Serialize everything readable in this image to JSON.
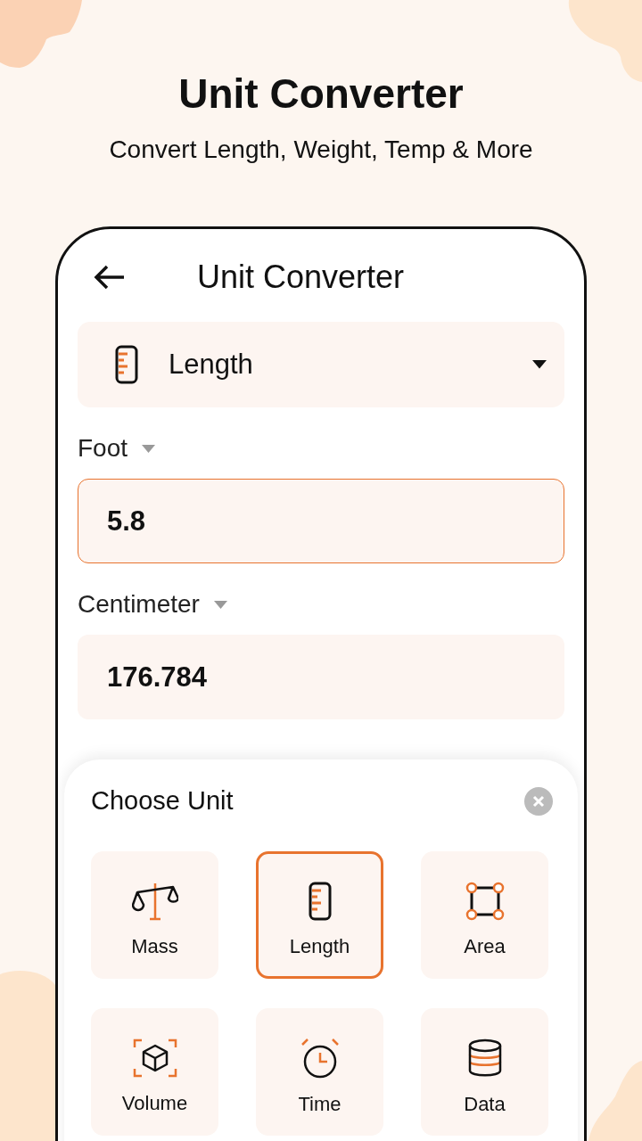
{
  "promo": {
    "title": "Unit Converter",
    "subtitle": "Convert Length, Weight, Temp & More"
  },
  "app_bar": {
    "title": "Unit Converter"
  },
  "category_select": {
    "value": "Length"
  },
  "from": {
    "unit": "Foot",
    "value": "5.8",
    "focused": true
  },
  "to": {
    "unit": "Centimeter",
    "value": "176.784",
    "focused": false
  },
  "sheet": {
    "title": "Choose Unit",
    "items": [
      {
        "label": "Mass",
        "selected": false
      },
      {
        "label": "Length",
        "selected": true
      },
      {
        "label": "Area",
        "selected": false
      },
      {
        "label": "Volume",
        "selected": false
      },
      {
        "label": "Time",
        "selected": false
      },
      {
        "label": "Data",
        "selected": false
      }
    ]
  }
}
